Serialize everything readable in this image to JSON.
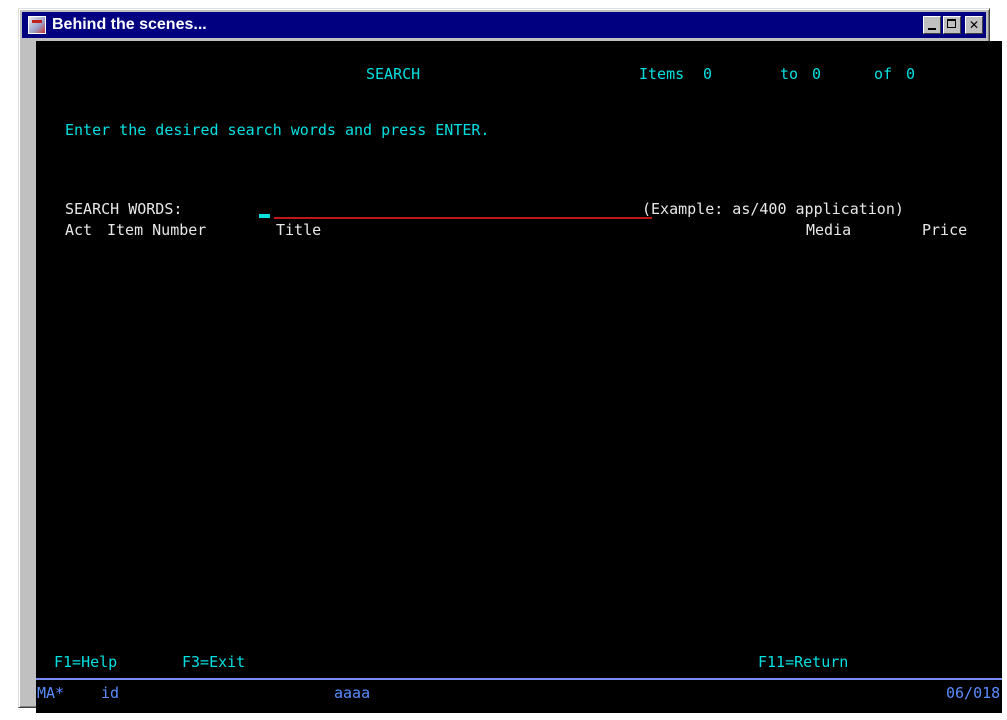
{
  "window": {
    "title": "Behind the scenes...",
    "buttons": [
      "minimize",
      "maximize",
      "close"
    ]
  },
  "screen": {
    "header_title": "SEARCH",
    "items_label": "Items",
    "items_from": "0",
    "to_label": "to",
    "items_to": "0",
    "of_label": "of",
    "items_total": "0",
    "instruction": "Enter the desired search words and press ENTER.",
    "search_label": "SEARCH WORDS:",
    "search_value": "",
    "example": "(Example: as/400 application)",
    "columns": {
      "act": "Act",
      "item_number": "Item Number",
      "title": "Title",
      "media": "Media",
      "price": "Price"
    },
    "function_keys": {
      "help": "F1=Help",
      "exit": "F3=Exit",
      "return": "F11=Return"
    }
  },
  "status_bar": {
    "mode": "MA*",
    "user": "id",
    "session": "aaaa",
    "position": "06/018"
  },
  "colors": {
    "background": "#000000",
    "field_text": "#00e0e0",
    "label_text": "#e8e8e8",
    "status_text": "#5a8cff",
    "input_underline": "#c01818",
    "titlebar": "#000080"
  }
}
